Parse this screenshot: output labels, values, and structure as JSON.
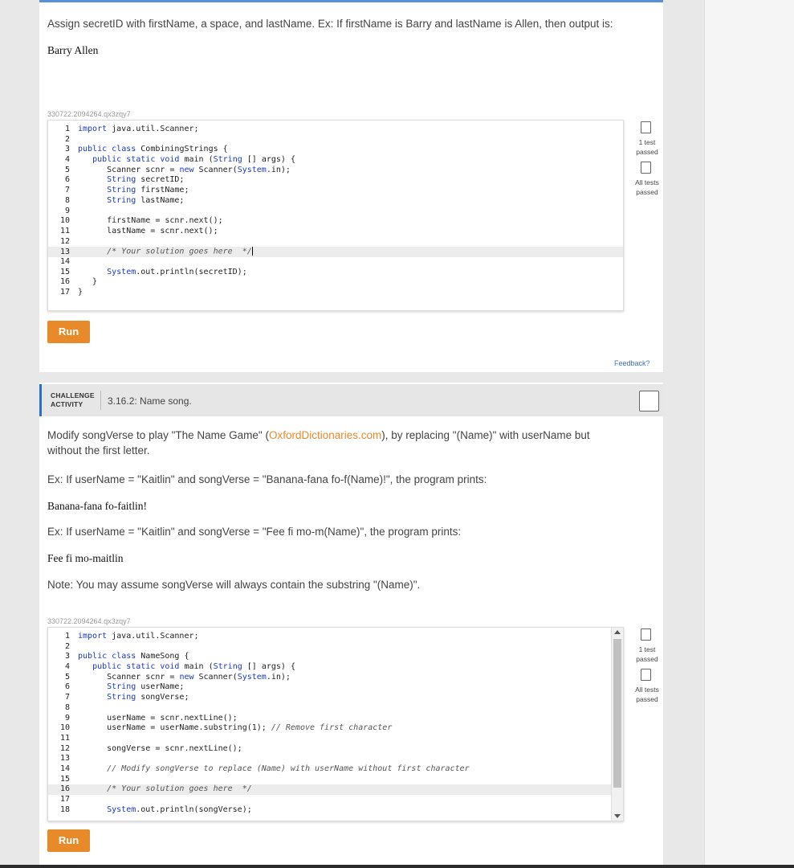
{
  "activity1": {
    "prompt": "Assign secretID with firstName, a space, and lastName. Ex: If firstName is Barry and lastName is Allen, then output is:",
    "sample_output": "Barry Allen",
    "identifier": "330722.2094264.qx3zqy7",
    "code": [
      {
        "n": "1",
        "t": "import java.util.Scanner;"
      },
      {
        "n": "2",
        "t": ""
      },
      {
        "n": "3",
        "t": "public class CombiningStrings {"
      },
      {
        "n": "4",
        "t": "   public static void main (String [] args) {"
      },
      {
        "n": "5",
        "t": "      Scanner scnr = new Scanner(System.in);"
      },
      {
        "n": "6",
        "t": "      String secretID;"
      },
      {
        "n": "7",
        "t": "      String firstName;"
      },
      {
        "n": "8",
        "t": "      String lastName;"
      },
      {
        "n": "9",
        "t": ""
      },
      {
        "n": "10",
        "t": "      firstName = scnr.next();"
      },
      {
        "n": "11",
        "t": "      lastName = scnr.next();"
      },
      {
        "n": "12",
        "t": ""
      },
      {
        "n": "13",
        "t": "      /* Your solution goes here  */"
      },
      {
        "n": "14",
        "t": ""
      },
      {
        "n": "15",
        "t": "      System.out.println(secretID);"
      },
      {
        "n": "16",
        "t": "   }"
      },
      {
        "n": "17",
        "t": "}"
      }
    ],
    "run_label": "Run",
    "test1_label": "1 test passed",
    "test2_label": "All tests passed",
    "feedback_label": "Feedback?"
  },
  "activity2": {
    "tag_line1": "CHALLENGE",
    "tag_line2": "ACTIVITY",
    "title": "3.16.2: Name song.",
    "prompt_before_link": "Modify songVerse to play \"The Name Game\" (",
    "link_text": "OxfordDictionaries.com",
    "prompt_after_link": "), by replacing \"(Name)\" with userName but without the first letter.",
    "example1": "Ex: If userName = \"Kaitlin\" and songVerse = \"Banana-fana fo-f(Name)!\", the program prints:",
    "sample1": "Banana-fana fo-faitlin!",
    "example2": "Ex: If userName = \"Kaitlin\" and songVerse = \"Fee fi mo-m(Name)\", the program prints:",
    "sample2": "Fee fi mo-maitlin",
    "note": "Note: You may assume songVerse will always contain the substring \"(Name)\".",
    "identifier": "330722.2094264.qx3zqy7",
    "code": [
      {
        "n": "1",
        "t": "import java.util.Scanner;"
      },
      {
        "n": "2",
        "t": ""
      },
      {
        "n": "3",
        "t": "public class NameSong {"
      },
      {
        "n": "4",
        "t": "   public static void main (String [] args) {"
      },
      {
        "n": "5",
        "t": "      Scanner scnr = new Scanner(System.in);"
      },
      {
        "n": "6",
        "t": "      String userName;"
      },
      {
        "n": "7",
        "t": "      String songVerse;"
      },
      {
        "n": "8",
        "t": ""
      },
      {
        "n": "9",
        "t": "      userName = scnr.nextLine();"
      },
      {
        "n": "10",
        "t": "      userName = userName.substring(1); // Remove first character"
      },
      {
        "n": "11",
        "t": ""
      },
      {
        "n": "12",
        "t": "      songVerse = scnr.nextLine();"
      },
      {
        "n": "13",
        "t": ""
      },
      {
        "n": "14",
        "t": "      // Modify songVerse to replace (Name) with userName without first character"
      },
      {
        "n": "15",
        "t": ""
      },
      {
        "n": "16",
        "t": "      /* Your solution goes here  */"
      },
      {
        "n": "17",
        "t": ""
      },
      {
        "n": "18",
        "t": "      System.out.println(songVerse);"
      }
    ],
    "run_label": "Run",
    "test1_label": "1 test passed",
    "test2_label": "All tests passed"
  },
  "colors": {
    "accent_orange": "#e98a2a",
    "link_blue": "#3b72c0",
    "keyword_blue": "#1a37c8"
  }
}
